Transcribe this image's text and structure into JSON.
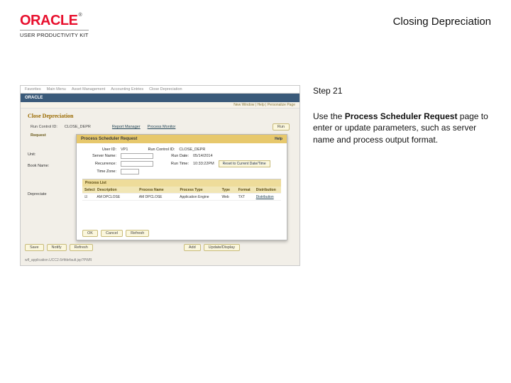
{
  "header": {
    "brand": "ORACLE",
    "tm": "®",
    "subbrand": "USER PRODUCTIVITY KIT",
    "title": "Closing Depreciation"
  },
  "step": {
    "label": "Step 21"
  },
  "instruction": {
    "pre": "Use the ",
    "bold": "Process Scheduler Request",
    "post": " page to enter or update parameters, such as server name and process output format."
  },
  "shot": {
    "top_tabs": [
      "Favorites",
      "Main Menu",
      "Asset Management",
      "Accounting Entries",
      "Close Depreciation"
    ],
    "orabar": "ORACLE",
    "subbar": "New Window | Help | Personalize Page",
    "page_title": "Close Depreciation",
    "run_ctl_lbl": "Run Control ID:",
    "run_ctl_val": "CLOSE_DEPR",
    "report_mgr": "Report Manager",
    "proc_mon": "Process Monitor",
    "run_btn": "Run",
    "request_hdr": "Request",
    "left_labels": [
      "Unit:",
      "Book Name:",
      "Depreciate"
    ],
    "panel": {
      "title": "Process Scheduler Request",
      "help": "Help",
      "userid_lbl": "User ID:",
      "userid_val": "VP1",
      "runctl_lbl": "Run Control ID:",
      "runctl_val": "CLOSE_DEPR",
      "server_lbl": "Server Name:",
      "rundate_lbl": "Run Date:",
      "rundate_val": "05/14/2014",
      "recur_lbl": "Recurrence:",
      "runtime_lbl": "Run Time:",
      "runtime_val": "10:33:22PM",
      "reset_btn": "Reset to Current Date/Time",
      "tz_lbl": "Time Zone:",
      "grid_title": "Process List",
      "cols": [
        "Select",
        "Description",
        "Process Name",
        "Process Type",
        "Type",
        "Format",
        "Distribution"
      ],
      "row": {
        "desc": "AM DPCLOSE",
        "pname": "AM DPCLOSE",
        "ptype": "Application Engine",
        "type": "Web",
        "format": "TXT",
        "dist": "Distribution"
      },
      "ok": "OK",
      "cancel": "Cancel",
      "refresh": "Refresh"
    },
    "footer_btns": [
      "Save",
      "Notify",
      "Refresh",
      "Add",
      "Update/Display"
    ],
    "url": "wlf_application.UCC2.6#ifdefault.jsp?PWR"
  }
}
